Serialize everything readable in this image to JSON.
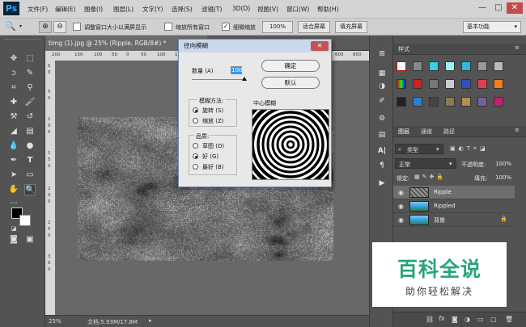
{
  "app": {
    "logo": "Ps"
  },
  "menu": [
    "文件(F)",
    "编辑(E)",
    "图像(I)",
    "图层(L)",
    "文字(Y)",
    "选择(S)",
    "滤镜(T)",
    "3D(D)",
    "视图(V)",
    "窗口(W)",
    "帮助(H)"
  ],
  "window_controls": {
    "minimize": "—",
    "maximize": "□",
    "close": "✕"
  },
  "options": {
    "resize_windows_label": "调整窗口大小以满屏显示",
    "zoom_all_label": "缩放所有窗口",
    "scrubby_zoom_label": "细微缩放",
    "zoom_value": "100%",
    "fit_screen": "适合屏幕",
    "fill_screen": "填充屏幕",
    "workspace": "基本功能"
  },
  "document": {
    "tab_title": "timg (1).jpg @ 25% (Ripple, RGB/8#) *",
    "tab_close": "×",
    "ruler_ticks": [
      "200",
      "150",
      "100",
      "50",
      "0",
      "50",
      "100",
      "150",
      "200",
      "250",
      "300",
      "350",
      "400",
      "450",
      "500",
      "550",
      "600",
      "650"
    ],
    "vruler_ticks": [
      "5",
      "0",
      "5",
      "0",
      "1",
      "0",
      "0",
      "1",
      "5",
      "0",
      "2",
      "0",
      "0",
      "2",
      "5",
      "0",
      "3",
      "0",
      "0"
    ],
    "zoom": "25%",
    "doc_size": "文档:5.93M/17.8M"
  },
  "dialog": {
    "title": "径向模糊",
    "close": "✕",
    "amount_label": "数量 (A)",
    "amount_value": "100",
    "ok": "确定",
    "reset": "默认",
    "method_title": "模糊方法:",
    "method_spin": "旋转 (S)",
    "method_zoom": "缩放 (Z)",
    "quality_title": "品质:",
    "quality_draft": "草图 (D)",
    "quality_good": "好 (G)",
    "quality_best": "最好 (B)",
    "center_label": "中心模糊"
  },
  "styles_panel": {
    "tab": "样式"
  },
  "layers_panel": {
    "tabs": [
      "图层",
      "通道",
      "路径"
    ],
    "filter_kind": "类型",
    "blend_mode": "正常",
    "opacity_label": "不透明度:",
    "opacity": "100%",
    "lock_label": "锁定:",
    "fill_label": "填充:",
    "fill": "100%",
    "layers": [
      {
        "name": "Ripple",
        "selected": true
      },
      {
        "name": "Rippled",
        "selected": false
      },
      {
        "name": "背景",
        "selected": false
      }
    ]
  },
  "watermark": {
    "title": "百科全说",
    "subtitle": "助你轻松解决"
  },
  "colors": {
    "accent": "#31a8ff",
    "panel": "#535353",
    "watermark_green": "#2aa37c"
  }
}
